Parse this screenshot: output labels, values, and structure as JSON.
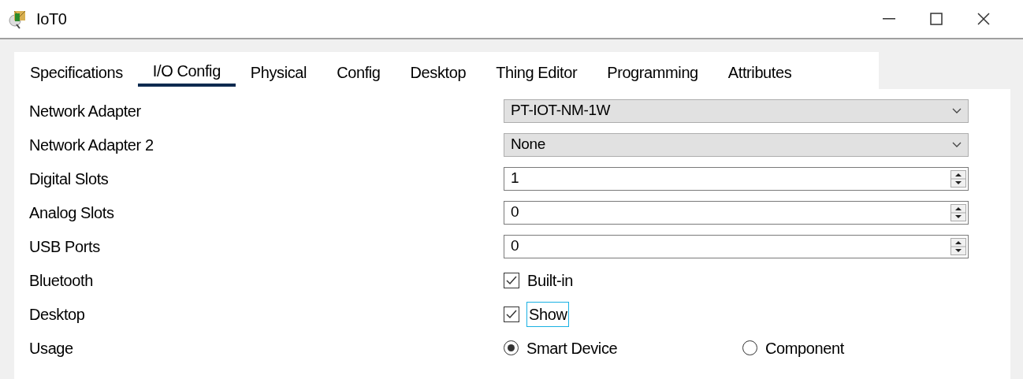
{
  "window": {
    "title": "IoT0"
  },
  "tabs": [
    {
      "label": "Specifications",
      "selected": false
    },
    {
      "label": "I/O Config",
      "selected": true
    },
    {
      "label": "Physical",
      "selected": false
    },
    {
      "label": "Config",
      "selected": false
    },
    {
      "label": "Desktop",
      "selected": false
    },
    {
      "label": "Thing Editor",
      "selected": false
    },
    {
      "label": "Programming",
      "selected": false
    },
    {
      "label": "Attributes",
      "selected": false
    }
  ],
  "settings": [
    {
      "label": "Network Adapter",
      "kind": "select",
      "value": "PT-IOT-NM-1W"
    },
    {
      "label": "Network Adapter 2",
      "kind": "select",
      "value": "None"
    },
    {
      "label": "Digital Slots",
      "kind": "spinner",
      "value": "1"
    },
    {
      "label": "Analog Slots",
      "kind": "spinner",
      "value": "0"
    },
    {
      "label": "USB Ports",
      "kind": "spinner",
      "value": "0"
    },
    {
      "label": "Bluetooth",
      "kind": "checkbox",
      "option": "Built-in",
      "checked": true,
      "focused": false
    },
    {
      "label": "Desktop",
      "kind": "checkbox",
      "option": "Show",
      "checked": true,
      "focused": true
    },
    {
      "label": "Usage",
      "kind": "radio",
      "options": [
        {
          "label": "Smart Device",
          "selected": true
        },
        {
          "label": "Component",
          "selected": false
        }
      ]
    }
  ]
}
